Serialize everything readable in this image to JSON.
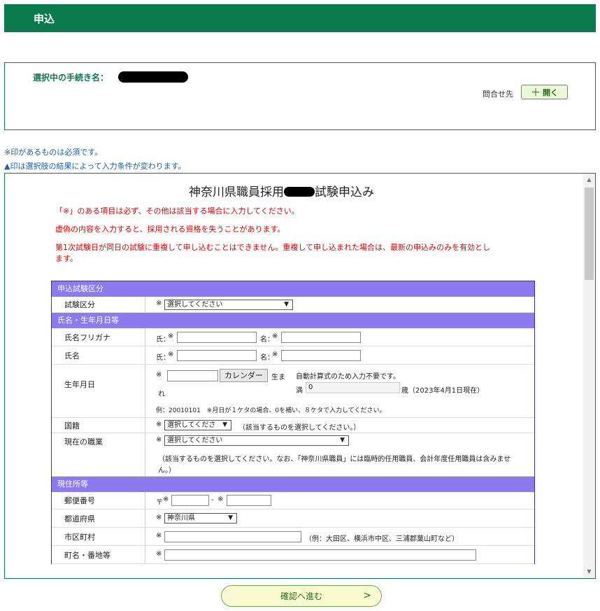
{
  "header": {
    "title": "申込"
  },
  "procedure": {
    "label": "選択中の手続き名：",
    "contact_label": "問合せ先",
    "open_button": "開く",
    "open_icon": "plus-icon"
  },
  "notes": {
    "required": "※印があるものは必須です。",
    "conditional": "▲印は選択肢の結果によって入力条件が変わります。"
  },
  "form": {
    "title_prefix": "神奈川県職員採用",
    "title_suffix": "試験申込み",
    "warnings": [
      "「※」のある項目は必ず、その他は該当する場合に入力してください。",
      "虚偽の内容を入力すると、採用される資格を失うことがあります。",
      "第1次試験日が同日の試験に重複して申し込むことはできません。重複して申し込まれた場合は、最新の申込みのみを有効とし",
      "ます。"
    ],
    "required_mark": "※",
    "sections": {
      "exam": "申込試験区分",
      "name": "氏名・生年月日等",
      "address": "現住所等"
    },
    "fields": {
      "exam_type": {
        "label": "試験区分",
        "value": "選択してください"
      },
      "furigana": {
        "label": "氏名フリガナ",
        "last": "氏：",
        "first": "名："
      },
      "name": {
        "label": "氏名",
        "last": "氏：",
        "first": "名："
      },
      "birthdate": {
        "label": "生年月日",
        "calendar_button": "カレンダー",
        "born": "生ま",
        "born2": "れ",
        "auto_note": "自動計算式のため入力不要です。",
        "man": "満",
        "age_value": "0",
        "age_suffix": "歳（2023年4月1日現在）",
        "example": "例：20010101　※月日が１ケタの場合、0を補い、８ケタで入力してください。"
      },
      "nationality": {
        "label": "国籍",
        "value": "選択してくださ",
        "hint": "（該当するものを選択してください。）"
      },
      "occupation": {
        "label": "現在の職業",
        "value": "選択してください",
        "hint1": "（該当するものを選択してください。なお、「神奈川県職員」には臨時的任用職員、会計年度任用職員は含みませ",
        "hint2": "ん。）"
      },
      "postal": {
        "label": "郵便番号",
        "prefix": "〒",
        "dash": "-"
      },
      "prefecture": {
        "label": "都道府県",
        "value": "神奈川県"
      },
      "city": {
        "label": "市区町村",
        "hint": "（例：大田区、横浜市中区、三浦郡葉山町など）"
      },
      "street": {
        "label": "町名・番地等"
      }
    }
  },
  "confirm_button": "確認へ進む",
  "confirm_arrow": ">"
}
